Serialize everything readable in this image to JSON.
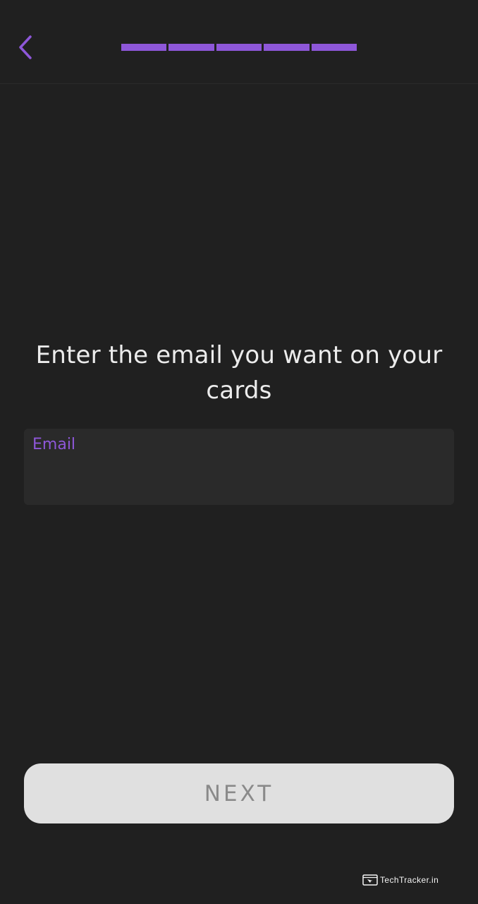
{
  "header": {
    "back_icon": "chevron-left-icon",
    "progress_total_steps": 5,
    "progress_completed_steps": 5,
    "accent_color": "#8e57d9"
  },
  "main": {
    "prompt": "Enter the email you want on your cards",
    "email_field": {
      "label": "Email",
      "value": ""
    }
  },
  "footer": {
    "next_label": "NEXT"
  },
  "watermark": {
    "text": "TechTracker.in",
    "icon": "browser-window-icon"
  }
}
